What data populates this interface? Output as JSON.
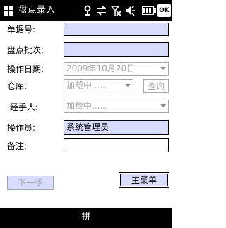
{
  "window": {
    "title": "盘点录入",
    "ok_label": "OK"
  },
  "status_icons": [
    "start-flag-icon",
    "sync-icon",
    "data-connection-icon",
    "no-signal-icon",
    "volume-icon",
    "battery-icon"
  ],
  "form": {
    "bill_no": {
      "label": "单据号:",
      "value": ""
    },
    "batch": {
      "label": "盘点批次:",
      "value": ""
    },
    "date": {
      "label": "操作日期:",
      "value": "2009年10月20日"
    },
    "warehouse": {
      "label": "仓库:",
      "value": "加载中......"
    },
    "query_label": "查询",
    "handler": {
      "label": "经手人:",
      "value": "加载中......"
    },
    "operator": {
      "label": "操作员:",
      "value": "系统管理员"
    },
    "remark": {
      "label": "备注:",
      "value": ""
    }
  },
  "buttons": {
    "next_label": "下一步",
    "menu_label": "主菜单"
  },
  "input_bar": {
    "ime_label": "拼"
  },
  "colors": {
    "title_bg": "#000000",
    "field_highlight": "#d8ddff",
    "disabled": "#a6a6a6"
  }
}
